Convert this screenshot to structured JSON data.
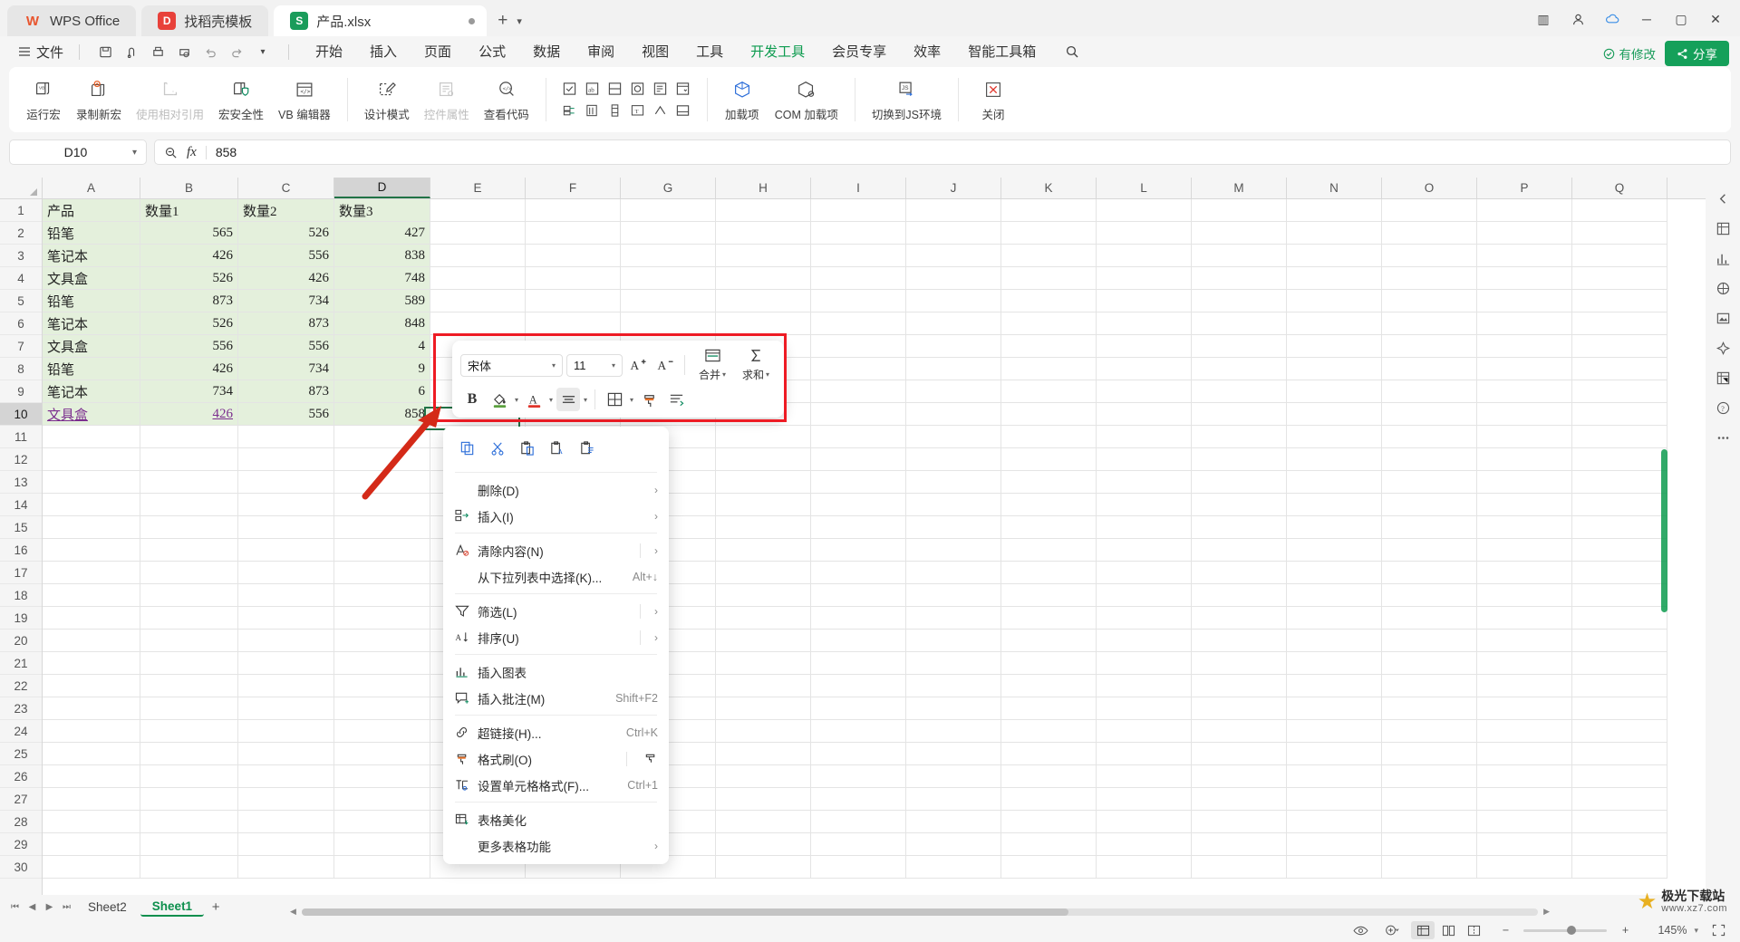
{
  "window": {
    "tabs": [
      {
        "label": "WPS Office",
        "icon": "wps-logo-icon"
      },
      {
        "label": "找稻壳模板",
        "icon": "template-icon"
      },
      {
        "label": "产品.xlsx",
        "icon": "excel-file-icon"
      }
    ],
    "new_tab": "+",
    "controls": {
      "minimize": "─",
      "maximize": "▢",
      "close": "✕",
      "sidebar": "▥",
      "user": "👤",
      "cloud": "☁"
    }
  },
  "menu": {
    "file_label": "文件",
    "quick_icons": [
      "save-icon",
      "cloud-save-icon",
      "print-icon",
      "print-preview-icon",
      "undo-icon",
      "redo-icon",
      "customize-icon"
    ],
    "ribbon_tabs": [
      {
        "label": "开始",
        "active": false
      },
      {
        "label": "插入",
        "active": false
      },
      {
        "label": "页面",
        "active": false
      },
      {
        "label": "公式",
        "active": false
      },
      {
        "label": "数据",
        "active": false
      },
      {
        "label": "审阅",
        "active": false
      },
      {
        "label": "视图",
        "active": false
      },
      {
        "label": "工具",
        "active": false
      },
      {
        "label": "开发工具",
        "active": true
      },
      {
        "label": "会员专享",
        "active": false
      },
      {
        "label": "效率",
        "active": false
      },
      {
        "label": "智能工具箱",
        "active": false
      }
    ],
    "search_icon": "search-icon",
    "saved_status": "有修改",
    "share_label": "分享",
    "accent_green": "#0d9b4f",
    "share_bg": "#15a05a"
  },
  "ribbon": {
    "groups": [
      {
        "buttons": [
          {
            "label": "运行宏",
            "icon": "run-macro-icon",
            "disabled": false
          },
          {
            "label": "录制新宏",
            "icon": "record-macro-icon",
            "disabled": false
          },
          {
            "label": "使用相对引用",
            "icon": "relative-reference-icon",
            "disabled": true
          },
          {
            "label": "宏安全性",
            "icon": "macro-security-icon",
            "disabled": false
          },
          {
            "label": "VB 编辑器",
            "icon": "vb-editor-icon",
            "disabled": false
          }
        ]
      },
      {
        "buttons": [
          {
            "label": "设计模式",
            "icon": "design-mode-icon",
            "disabled": false
          },
          {
            "label": "控件属性",
            "icon": "control-properties-icon",
            "disabled": true
          },
          {
            "label": "查看代码",
            "icon": "view-code-icon",
            "disabled": false
          }
        ]
      },
      {
        "controls_grid": [
          "checkbox-control-icon",
          "label-control-icon",
          "button-control-icon",
          "option-control-icon",
          "listbox-control-icon",
          "combobox-control-icon",
          "groupbox-control-icon",
          "spinner-control-icon",
          "scrollbar-control-icon",
          "textbox-control-icon",
          "toggle-control-icon",
          "frame-control-icon"
        ]
      },
      {
        "buttons": [
          {
            "label": "加载项",
            "icon": "addin-icon",
            "disabled": false
          },
          {
            "label": "COM 加载项",
            "icon": "com-addin-icon",
            "disabled": false
          }
        ]
      },
      {
        "buttons": [
          {
            "label": "切换到JS环境",
            "icon": "js-environment-icon",
            "disabled": false
          }
        ]
      },
      {
        "buttons": [
          {
            "label": "关闭",
            "icon": "close-red-x-icon",
            "disabled": false
          }
        ]
      }
    ]
  },
  "formula_bar": {
    "name_box_value": "D10",
    "dropdown_icon": "chevron-down-icon",
    "zoom_icon": "zoom-out-icon",
    "fx_label": "fx",
    "value": "858"
  },
  "grid": {
    "columns": [
      "A",
      "B",
      "C",
      "D",
      "E",
      "F",
      "G",
      "H",
      "I",
      "J",
      "K",
      "L",
      "M",
      "N",
      "O",
      "P",
      "Q"
    ],
    "selected_column": "D",
    "selected_row": 10,
    "rows": [
      {
        "n": 1,
        "cells": [
          "产品",
          "数量1",
          "数量2",
          "数量3"
        ],
        "filled": true,
        "header": true
      },
      {
        "n": 2,
        "cells": [
          "铅笔",
          "565",
          "526",
          "427"
        ],
        "filled": true
      },
      {
        "n": 3,
        "cells": [
          "笔记本",
          "426",
          "556",
          "838"
        ],
        "filled": true
      },
      {
        "n": 4,
        "cells": [
          "文具盒",
          "526",
          "426",
          "748"
        ],
        "filled": true
      },
      {
        "n": 5,
        "cells": [
          "铅笔",
          "873",
          "734",
          "589"
        ],
        "filled": true
      },
      {
        "n": 6,
        "cells": [
          "笔记本",
          "526",
          "873",
          "848"
        ],
        "filled": true
      },
      {
        "n": 7,
        "cells": [
          "文具盒",
          "556",
          "556",
          "4"
        ],
        "filled": true
      },
      {
        "n": 8,
        "cells": [
          "铅笔",
          "426",
          "734",
          "9"
        ],
        "filled": true
      },
      {
        "n": 9,
        "cells": [
          "笔记本",
          "734",
          "873",
          "6"
        ],
        "filled": true
      },
      {
        "n": 10,
        "cells": [
          "文具盒",
          "426",
          "556",
          "858"
        ],
        "filled": true,
        "link": true
      },
      {
        "n": 11,
        "cells": [
          "",
          "",
          "",
          ""
        ],
        "filled": false
      },
      {
        "n": 12,
        "cells": [
          "",
          "",
          "",
          ""
        ],
        "filled": false
      },
      {
        "n": 13,
        "cells": [
          "",
          "",
          "",
          ""
        ],
        "filled": false
      },
      {
        "n": 14,
        "cells": [
          "",
          "",
          "",
          ""
        ],
        "filled": false
      },
      {
        "n": 15,
        "cells": [
          "",
          "",
          "",
          ""
        ],
        "filled": false
      },
      {
        "n": 16,
        "cells": [
          "",
          "",
          "",
          ""
        ],
        "filled": false
      },
      {
        "n": 17,
        "cells": [
          "",
          "",
          "",
          ""
        ],
        "filled": false
      },
      {
        "n": 18,
        "cells": [
          "",
          "",
          "",
          ""
        ],
        "filled": false
      },
      {
        "n": 19,
        "cells": [
          "",
          "",
          "",
          ""
        ],
        "filled": false
      },
      {
        "n": 20,
        "cells": [
          "",
          "",
          "",
          ""
        ],
        "filled": false
      },
      {
        "n": 21,
        "cells": [
          "",
          "",
          "",
          ""
        ],
        "filled": false
      },
      {
        "n": 22,
        "cells": [
          "",
          "",
          "",
          ""
        ],
        "filled": false
      },
      {
        "n": 23,
        "cells": [
          "",
          "",
          "",
          ""
        ],
        "filled": false
      },
      {
        "n": 24,
        "cells": [
          "",
          "",
          "",
          ""
        ],
        "filled": false
      },
      {
        "n": 25,
        "cells": [
          "",
          "",
          "",
          ""
        ],
        "filled": false
      },
      {
        "n": 26,
        "cells": [
          "",
          "",
          "",
          ""
        ],
        "filled": false
      },
      {
        "n": 27,
        "cells": [
          "",
          "",
          "",
          ""
        ],
        "filled": false
      },
      {
        "n": 28,
        "cells": [
          "",
          "",
          "",
          ""
        ],
        "filled": false
      },
      {
        "n": 29,
        "cells": [
          "",
          "",
          "",
          ""
        ],
        "filled": false
      },
      {
        "n": 30,
        "cells": [
          "",
          "",
          "",
          ""
        ],
        "filled": false
      }
    ],
    "fill_color": "#e4f0dc",
    "link_color": "#7b2d8e",
    "selection_color": "#217346"
  },
  "mini_toolbar": {
    "font_name": "宋体",
    "font_size": "11",
    "increase_font": "A⁺",
    "decrease_font": "A⁻",
    "bold": "B",
    "fill_color_icon": "fill-color-icon",
    "font_color_icon": "font-color-icon",
    "align_icon": "align-icon",
    "border_icon": "border-icon",
    "format_painter_icon": "format-painter-icon",
    "wrap_text_icon": "wrap-text-icon",
    "merge_label": "合并",
    "merge_icon": "merge-cells-icon",
    "sum_label": "求和",
    "sum_icon": "autosum-icon"
  },
  "context_menu": {
    "tool_icons": [
      "copy-icon",
      "cut-icon",
      "paste-icon",
      "paste-values-icon",
      "paste-format-icon"
    ],
    "items": [
      {
        "label": "删除(D)",
        "icon": "delete-icon",
        "submenu": true,
        "accel": "",
        "divider_before": false,
        "has_isep": false
      },
      {
        "label": "插入(I)",
        "icon": "insert-icon",
        "submenu": true,
        "accel": "",
        "divider_before": false,
        "has_isep": false
      },
      {
        "label": "清除内容(N)",
        "icon": "clear-content-icon",
        "submenu": true,
        "accel": "",
        "divider_before": true,
        "has_isep": true
      },
      {
        "label": "从下拉列表中选择(K)...",
        "icon": "",
        "submenu": false,
        "accel": "Alt+↓",
        "divider_before": false,
        "has_isep": false
      },
      {
        "label": "筛选(L)",
        "icon": "filter-icon",
        "submenu": true,
        "accel": "",
        "divider_before": true,
        "has_isep": true
      },
      {
        "label": "排序(U)",
        "icon": "sort-icon",
        "submenu": true,
        "accel": "",
        "divider_before": false,
        "has_isep": true
      },
      {
        "label": "插入图表",
        "icon": "insert-chart-icon",
        "submenu": false,
        "accel": "",
        "divider_before": true,
        "has_isep": false
      },
      {
        "label": "插入批注(M)",
        "icon": "insert-comment-icon",
        "submenu": false,
        "accel": "Shift+F2",
        "divider_before": false,
        "has_isep": false
      },
      {
        "label": "超链接(H)...",
        "icon": "hyperlink-icon",
        "submenu": false,
        "accel": "Ctrl+K",
        "divider_before": true,
        "has_isep": false
      },
      {
        "label": "格式刷(O)",
        "icon": "format-painter-icon",
        "submenu": false,
        "accel": "",
        "divider_before": false,
        "has_isep": true,
        "trailing_icon": "format-painter-small-icon"
      },
      {
        "label": "设置单元格格式(F)...",
        "icon": "cell-format-icon",
        "submenu": false,
        "accel": "Ctrl+1",
        "divider_before": false,
        "has_isep": false
      },
      {
        "label": "表格美化",
        "icon": "table-beautify-icon",
        "submenu": false,
        "accel": "",
        "divider_before": true,
        "has_isep": false
      },
      {
        "label": "更多表格功能",
        "icon": "",
        "submenu": true,
        "accel": "",
        "divider_before": false,
        "has_isep": false
      }
    ]
  },
  "right_sidebar": {
    "icons": [
      "collapse-icon",
      "cell-format-panel-icon",
      "chart-panel-icon",
      "shape-panel-icon",
      "picture-panel-icon",
      "smart-panel-icon",
      "pivot-panel-icon",
      "help-icon",
      "more-panel-icon"
    ]
  },
  "sheet_bar": {
    "nav": [
      "⏮",
      "◀",
      "▶",
      "⏭"
    ],
    "sheets": [
      {
        "label": "Sheet2",
        "active": false
      },
      {
        "label": "Sheet1",
        "active": true
      }
    ],
    "add_label": "+"
  },
  "status_bar": {
    "eye_icon": "preview-icon",
    "add_icon": "add-view-icon",
    "view_buttons": [
      "normal-view-icon",
      "page-layout-icon",
      "page-break-icon"
    ],
    "zoom_out": "−",
    "zoom_in": "+",
    "zoom_percent": "145%",
    "fullscreen_icon": "fullscreen-icon"
  },
  "watermark": {
    "line1": "极光下载站",
    "line2": "www.xz7.com"
  },
  "annotations": {
    "highlight_color": "#ee1b24",
    "arrow_color": "#d42a18"
  }
}
